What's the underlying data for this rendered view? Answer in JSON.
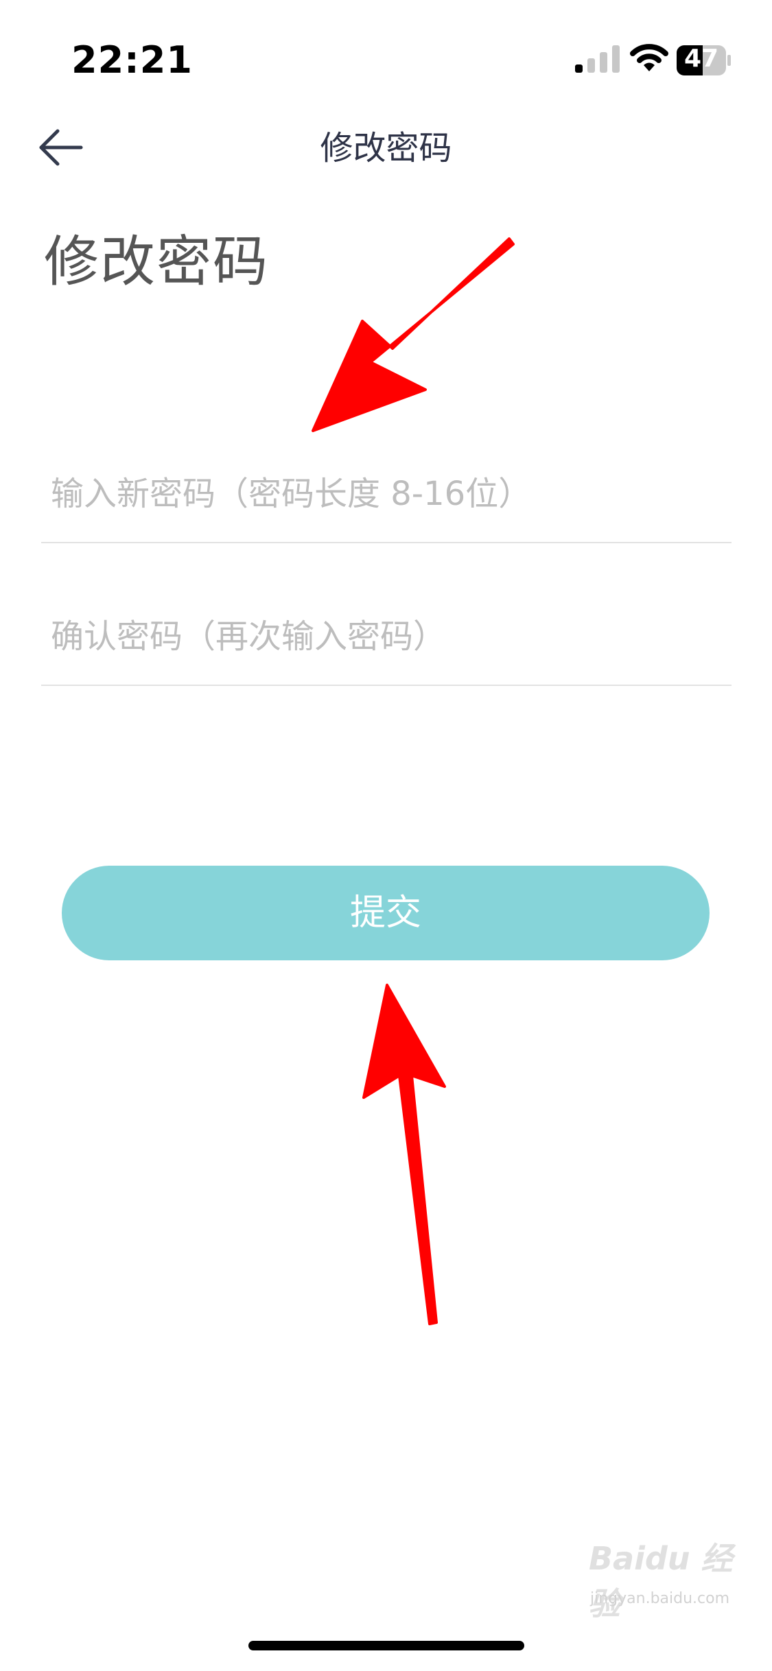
{
  "status_bar": {
    "time": "22:21",
    "battery": "47"
  },
  "nav": {
    "title": "修改密码"
  },
  "page": {
    "heading": "修改密码"
  },
  "form": {
    "new_password_placeholder": "输入新密码（密码长度 8-16位）",
    "confirm_password_placeholder": "确认密码（再次输入密码）",
    "submit_label": "提交"
  },
  "watermark": {
    "brand": "Baidu 经验",
    "url": "jingyan.baidu.com"
  },
  "colors": {
    "accent": "#86d4d9",
    "annotation_arrow": "#ff0000"
  },
  "icons": {
    "back": "arrow-left-icon",
    "signal": "cellular-signal-icon",
    "wifi": "wifi-icon",
    "battery": "battery-icon"
  }
}
